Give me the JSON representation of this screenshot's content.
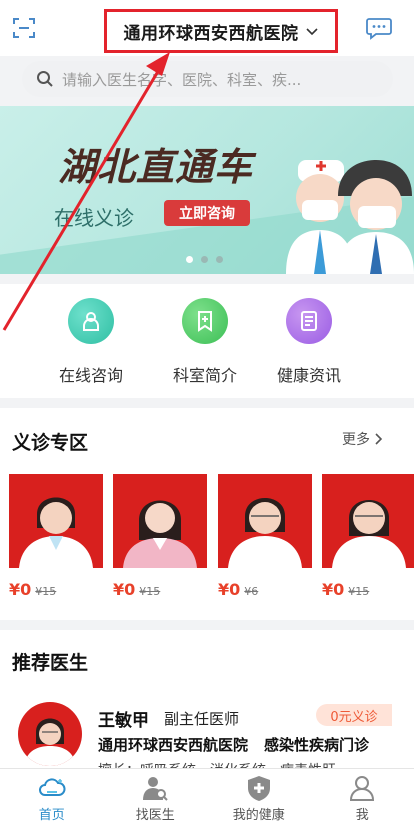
{
  "header": {
    "hospital_name": "通用环球西安西航医院",
    "scan_icon": "scan-icon",
    "message_icon": "message-icon"
  },
  "search": {
    "placeholder": "请输入医生名字、医院、科室、疾..."
  },
  "banner": {
    "title": "湖北直通车",
    "subtitle": "在线义诊",
    "cta_label": "立即咨询",
    "slide_count": 3,
    "active_slide": 1
  },
  "quick_menu": [
    {
      "label": "在线咨询",
      "icon": "consult-icon",
      "color": "#3ccbb0"
    },
    {
      "label": "科室简介",
      "icon": "department-icon",
      "color": "#4cc96a"
    },
    {
      "label": "健康资讯",
      "icon": "news-icon",
      "color": "#a66be8"
    }
  ],
  "free_clinic": {
    "title": "义诊专区",
    "more_label": "更多",
    "doctors": [
      {
        "price": "¥0",
        "original": "¥15"
      },
      {
        "price": "¥0",
        "original": "¥15"
      },
      {
        "price": "¥0",
        "original": "¥6"
      },
      {
        "price": "¥0",
        "original": "¥15"
      }
    ]
  },
  "recommend": {
    "title": "推荐医生",
    "doctor": {
      "name": "王敏甲",
      "rank": "副主任医师",
      "badge": "0元义诊",
      "hospital": "通用环球西安西航医院",
      "department": "感染性疾病门诊",
      "skill": "擅长：呼吸系统、消化系统、病毒性肝..."
    }
  },
  "tabbar": [
    {
      "label": "首页",
      "icon": "home-cloud-icon",
      "active": true
    },
    {
      "label": "找医生",
      "icon": "find-doctor-icon",
      "active": false
    },
    {
      "label": "我的健康",
      "icon": "health-shield-icon",
      "active": false
    },
    {
      "label": "我",
      "icon": "profile-icon",
      "active": false
    }
  ],
  "colors": {
    "accent_blue": "#2a8cc9",
    "price_red": "#e8412a",
    "highlight_box": "#e3232c"
  }
}
